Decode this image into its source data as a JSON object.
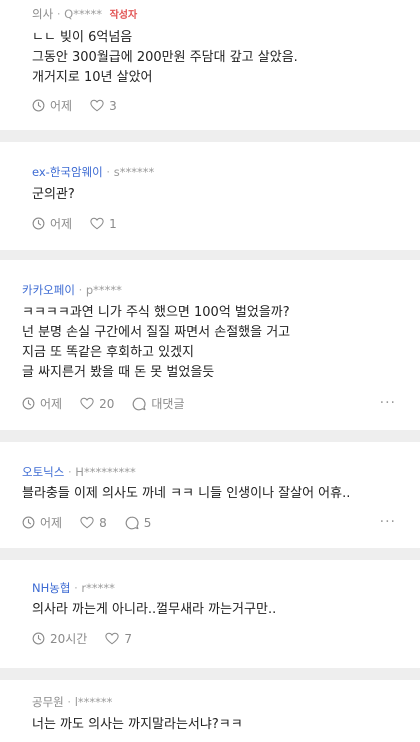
{
  "comments": [
    {
      "company": "의사",
      "user": "Q*****",
      "badge": "작성자",
      "lines": [
        "ㄴㄴ 빚이 6억넘음",
        "그동안 300월급에 200만원 주담대 갚고 살았음.",
        "개거지로 10년 살았어"
      ],
      "time": "어제",
      "likes": "3"
    },
    {
      "company": "ex-한국암웨이",
      "user": "s******",
      "lines": [
        "군의관?"
      ],
      "time": "어제",
      "likes": "1"
    },
    {
      "company": "카카오페이",
      "user": "p*****",
      "lines": [
        "ㅋㅋㅋㅋ과연 니가 주식 했으면 100억 벌었을까?",
        "넌 분명 손실 구간에서 질질 짜면서 손절했을 거고",
        "지금 또 똑같은 후회하고 있겠지",
        "글 싸지른거 봤을 때 돈 못 벌었을듯"
      ],
      "time": "어제",
      "likes": "20",
      "reply_label": "대댓글",
      "more": "···"
    },
    {
      "company": "오토닉스",
      "user": "H*********",
      "lines": [
        "블라충들 이제 의사도 까네 ㅋㅋ 니들 인생이나 잘살어 어휴.."
      ],
      "time": "어제",
      "likes": "8",
      "replies": "5",
      "more": "···"
    },
    {
      "company": "NH농협",
      "user": "r*****",
      "lines": [
        "의사라 까는게 아니라..껄무새라 까는거구만.."
      ],
      "time": "20시간",
      "likes": "7"
    },
    {
      "company": "공무원",
      "user": "l******",
      "lines": [
        "너는 까도 의사는 까지말라는서냐?ㅋㅋ"
      ]
    }
  ],
  "separator": "·",
  "colors": {
    "company_link": "#3d6bd3",
    "badge": "#e25555",
    "muted": "#8a8a8a"
  }
}
